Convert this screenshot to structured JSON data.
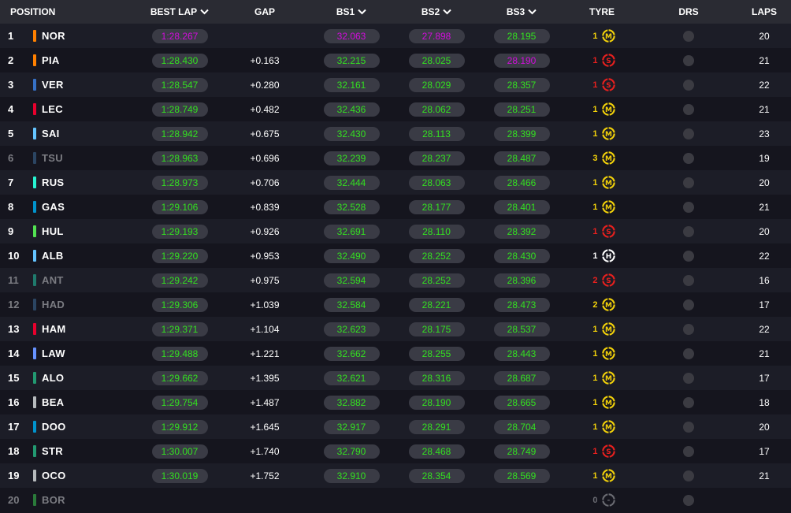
{
  "headers": {
    "position": "POSITION",
    "best_lap": "BEST LAP",
    "gap": "GAP",
    "bs1": "BS1",
    "bs2": "BS2",
    "bs3": "BS3",
    "tyre": "TYRE",
    "drs": "DRS",
    "laps": "LAPS"
  },
  "colors": {
    "green": "#33e020",
    "purple": "#d10ddb",
    "medium": "#f2d10a",
    "soft": "#e8201e",
    "hard": "#ffffff",
    "unknown": "#6a6b72"
  },
  "rows": [
    {
      "pos": "1",
      "code": "NOR",
      "team_color": "#ff8000",
      "dim": false,
      "best": "1:28.267",
      "best_purple": true,
      "gap": "",
      "bs1": "32.063",
      "bs1_purple": true,
      "bs2": "27.898",
      "bs2_purple": true,
      "bs3": "28.195",
      "bs3_purple": false,
      "tyre_age": "1",
      "tyre": "M",
      "tyre_icon": "medium-tyre-icon",
      "laps": "20"
    },
    {
      "pos": "2",
      "code": "PIA",
      "team_color": "#ff8000",
      "dim": false,
      "best": "1:28.430",
      "best_purple": false,
      "gap": "+0.163",
      "bs1": "32.215",
      "bs1_purple": false,
      "bs2": "28.025",
      "bs2_purple": false,
      "bs3": "28.190",
      "bs3_purple": true,
      "tyre_age": "1",
      "tyre": "S",
      "tyre_icon": "soft-tyre-icon",
      "laps": "21"
    },
    {
      "pos": "3",
      "code": "VER",
      "team_color": "#3671c6",
      "dim": false,
      "best": "1:28.547",
      "best_purple": false,
      "gap": "+0.280",
      "bs1": "32.161",
      "bs1_purple": false,
      "bs2": "28.029",
      "bs2_purple": false,
      "bs3": "28.357",
      "bs3_purple": false,
      "tyre_age": "1",
      "tyre": "S",
      "tyre_icon": "soft-tyre-icon",
      "laps": "22"
    },
    {
      "pos": "4",
      "code": "LEC",
      "team_color": "#e8002d",
      "dim": false,
      "best": "1:28.749",
      "best_purple": false,
      "gap": "+0.482",
      "bs1": "32.436",
      "bs1_purple": false,
      "bs2": "28.062",
      "bs2_purple": false,
      "bs3": "28.251",
      "bs3_purple": false,
      "tyre_age": "1",
      "tyre": "M",
      "tyre_icon": "medium-tyre-icon",
      "laps": "21"
    },
    {
      "pos": "5",
      "code": "SAI",
      "team_color": "#64c4ff",
      "dim": false,
      "best": "1:28.942",
      "best_purple": false,
      "gap": "+0.675",
      "bs1": "32.430",
      "bs1_purple": false,
      "bs2": "28.113",
      "bs2_purple": false,
      "bs3": "28.399",
      "bs3_purple": false,
      "tyre_age": "1",
      "tyre": "M",
      "tyre_icon": "medium-tyre-icon",
      "laps": "23"
    },
    {
      "pos": "6",
      "code": "TSU",
      "team_color": "#2b4562",
      "dim": true,
      "best": "1:28.963",
      "best_purple": false,
      "gap": "+0.696",
      "bs1": "32.239",
      "bs1_purple": false,
      "bs2": "28.237",
      "bs2_purple": false,
      "bs3": "28.487",
      "bs3_purple": false,
      "tyre_age": "3",
      "tyre": "M",
      "tyre_icon": "medium-tyre-icon",
      "laps": "19"
    },
    {
      "pos": "7",
      "code": "RUS",
      "team_color": "#27f4d2",
      "dim": false,
      "best": "1:28.973",
      "best_purple": false,
      "gap": "+0.706",
      "bs1": "32.444",
      "bs1_purple": false,
      "bs2": "28.063",
      "bs2_purple": false,
      "bs3": "28.466",
      "bs3_purple": false,
      "tyre_age": "1",
      "tyre": "M",
      "tyre_icon": "medium-tyre-icon",
      "laps": "20"
    },
    {
      "pos": "8",
      "code": "GAS",
      "team_color": "#0093cc",
      "dim": false,
      "best": "1:29.106",
      "best_purple": false,
      "gap": "+0.839",
      "bs1": "32.528",
      "bs1_purple": false,
      "bs2": "28.177",
      "bs2_purple": false,
      "bs3": "28.401",
      "bs3_purple": false,
      "tyre_age": "1",
      "tyre": "M",
      "tyre_icon": "medium-tyre-icon",
      "laps": "21"
    },
    {
      "pos": "9",
      "code": "HUL",
      "team_color": "#52e252",
      "dim": false,
      "best": "1:29.193",
      "best_purple": false,
      "gap": "+0.926",
      "bs1": "32.691",
      "bs1_purple": false,
      "bs2": "28.110",
      "bs2_purple": false,
      "bs3": "28.392",
      "bs3_purple": false,
      "tyre_age": "1",
      "tyre": "S",
      "tyre_icon": "soft-tyre-icon",
      "laps": "20"
    },
    {
      "pos": "10",
      "code": "ALB",
      "team_color": "#64c4ff",
      "dim": false,
      "best": "1:29.220",
      "best_purple": false,
      "gap": "+0.953",
      "bs1": "32.490",
      "bs1_purple": false,
      "bs2": "28.252",
      "bs2_purple": false,
      "bs3": "28.430",
      "bs3_purple": false,
      "tyre_age": "1",
      "tyre": "H",
      "tyre_icon": "hard-tyre-icon",
      "laps": "22"
    },
    {
      "pos": "11",
      "code": "ANT",
      "team_color": "#1f7a6c",
      "dim": true,
      "best": "1:29.242",
      "best_purple": false,
      "gap": "+0.975",
      "bs1": "32.594",
      "bs1_purple": false,
      "bs2": "28.252",
      "bs2_purple": false,
      "bs3": "28.396",
      "bs3_purple": false,
      "tyre_age": "2",
      "tyre": "S",
      "tyre_icon": "soft-tyre-icon",
      "laps": "16"
    },
    {
      "pos": "12",
      "code": "HAD",
      "team_color": "#2b4562",
      "dim": true,
      "best": "1:29.306",
      "best_purple": false,
      "gap": "+1.039",
      "bs1": "32.584",
      "bs1_purple": false,
      "bs2": "28.221",
      "bs2_purple": false,
      "bs3": "28.473",
      "bs3_purple": false,
      "tyre_age": "2",
      "tyre": "M",
      "tyre_icon": "medium-tyre-icon",
      "laps": "17"
    },
    {
      "pos": "13",
      "code": "HAM",
      "team_color": "#e8002d",
      "dim": false,
      "best": "1:29.371",
      "best_purple": false,
      "gap": "+1.104",
      "bs1": "32.623",
      "bs1_purple": false,
      "bs2": "28.175",
      "bs2_purple": false,
      "bs3": "28.537",
      "bs3_purple": false,
      "tyre_age": "1",
      "tyre": "M",
      "tyre_icon": "medium-tyre-icon",
      "laps": "22"
    },
    {
      "pos": "14",
      "code": "LAW",
      "team_color": "#6692ff",
      "dim": false,
      "best": "1:29.488",
      "best_purple": false,
      "gap": "+1.221",
      "bs1": "32.662",
      "bs1_purple": false,
      "bs2": "28.255",
      "bs2_purple": false,
      "bs3": "28.443",
      "bs3_purple": false,
      "tyre_age": "1",
      "tyre": "M",
      "tyre_icon": "medium-tyre-icon",
      "laps": "21"
    },
    {
      "pos": "15",
      "code": "ALO",
      "team_color": "#229971",
      "dim": false,
      "best": "1:29.662",
      "best_purple": false,
      "gap": "+1.395",
      "bs1": "32.621",
      "bs1_purple": false,
      "bs2": "28.316",
      "bs2_purple": false,
      "bs3": "28.687",
      "bs3_purple": false,
      "tyre_age": "1",
      "tyre": "M",
      "tyre_icon": "medium-tyre-icon",
      "laps": "17"
    },
    {
      "pos": "16",
      "code": "BEA",
      "team_color": "#b6babd",
      "dim": false,
      "best": "1:29.754",
      "best_purple": false,
      "gap": "+1.487",
      "bs1": "32.882",
      "bs1_purple": false,
      "bs2": "28.190",
      "bs2_purple": false,
      "bs3": "28.665",
      "bs3_purple": false,
      "tyre_age": "1",
      "tyre": "M",
      "tyre_icon": "medium-tyre-icon",
      "laps": "18"
    },
    {
      "pos": "17",
      "code": "DOO",
      "team_color": "#0093cc",
      "dim": false,
      "best": "1:29.912",
      "best_purple": false,
      "gap": "+1.645",
      "bs1": "32.917",
      "bs1_purple": false,
      "bs2": "28.291",
      "bs2_purple": false,
      "bs3": "28.704",
      "bs3_purple": false,
      "tyre_age": "1",
      "tyre": "M",
      "tyre_icon": "medium-tyre-icon",
      "laps": "20"
    },
    {
      "pos": "18",
      "code": "STR",
      "team_color": "#229971",
      "dim": false,
      "best": "1:30.007",
      "best_purple": false,
      "gap": "+1.740",
      "bs1": "32.790",
      "bs1_purple": false,
      "bs2": "28.468",
      "bs2_purple": false,
      "bs3": "28.749",
      "bs3_purple": false,
      "tyre_age": "1",
      "tyre": "S",
      "tyre_icon": "soft-tyre-icon",
      "laps": "17"
    },
    {
      "pos": "19",
      "code": "OCO",
      "team_color": "#b6babd",
      "dim": false,
      "best": "1:30.019",
      "best_purple": false,
      "gap": "+1.752",
      "bs1": "32.910",
      "bs1_purple": false,
      "bs2": "28.354",
      "bs2_purple": false,
      "bs3": "28.569",
      "bs3_purple": false,
      "tyre_age": "1",
      "tyre": "M",
      "tyre_icon": "medium-tyre-icon",
      "laps": "21"
    },
    {
      "pos": "20",
      "code": "BOR",
      "team_color": "#2a7a3a",
      "dim": true,
      "best": "",
      "best_purple": false,
      "gap": "",
      "bs1": "",
      "bs1_purple": false,
      "bs2": "",
      "bs2_purple": false,
      "bs3": "",
      "bs3_purple": false,
      "tyre_age": "0",
      "tyre": "-",
      "tyre_icon": "unknown-tyre-icon",
      "laps": ""
    }
  ]
}
